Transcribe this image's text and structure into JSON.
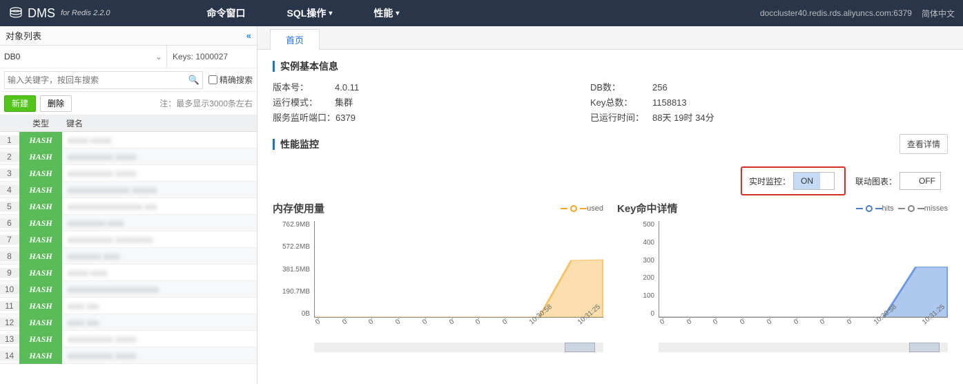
{
  "brand": "DMS",
  "brand_sub": "for Redis 2.2.0",
  "nav": {
    "cmd": "命令窗口",
    "sql": "SQL操作",
    "perf": "性能"
  },
  "host": "doccluster40.redis.rds.aliyuncs.com:6379",
  "lang": "简体中文",
  "sidebar": {
    "title": "对象列表",
    "db": "DB0",
    "keys_label": "Keys: 1000027",
    "search_placeholder": "输入关键字，按回车搜索",
    "exact_label": "精确搜索",
    "new_btn": "新建",
    "del_btn": "删除",
    "note": "注：最多显示3000条左右",
    "th_type": "类型",
    "th_key": "键名",
    "rows": [
      {
        "idx": "1",
        "type": "HASH",
        "key": "xxxxx   xxxxx"
      },
      {
        "idx": "2",
        "type": "HASH",
        "key": "xxxxxxxxxxx   xxxxx"
      },
      {
        "idx": "3",
        "type": "HASH",
        "key": "xxxxxxxxxxx   xxxxx"
      },
      {
        "idx": "4",
        "type": "HASH",
        "key": "xxxxxxxxxxxxxxx  xxxxxx"
      },
      {
        "idx": "5",
        "type": "HASH",
        "key": "xxxxxxxxxxxxxxxxxx  xxx"
      },
      {
        "idx": "6",
        "type": "HASH",
        "key": "xxxxxxxxx  xxxx"
      },
      {
        "idx": "7",
        "type": "HASH",
        "key": "xxxxxxxxxxx  xxxxxxxxx"
      },
      {
        "idx": "8",
        "type": "HASH",
        "key": "xxxxxxxx  xxxx"
      },
      {
        "idx": "9",
        "type": "HASH",
        "key": "xxxxx  xxxx"
      },
      {
        "idx": "10",
        "type": "HASH",
        "key": "xxxxxxxxxxxxxxxxxxxxxx"
      },
      {
        "idx": "11",
        "type": "HASH",
        "key": "xxxx  xxx"
      },
      {
        "idx": "12",
        "type": "HASH",
        "key": "xxxx  xxx"
      },
      {
        "idx": "13",
        "type": "HASH",
        "key": "xxxxxxxxxxx   xxxxx"
      },
      {
        "idx": "14",
        "type": "HASH",
        "key": "xxxxxxxxxxx   xxxxx"
      }
    ]
  },
  "main": {
    "tab_home": "首页",
    "section1": "实例基本信息",
    "info": {
      "version_k": "版本号：",
      "version_v": "4.0.11",
      "mode_k": "运行模式：",
      "mode_v": "集群",
      "port_k": "服务监听端口：",
      "port_v": "6379",
      "dbnum_k": "DB数：",
      "dbnum_v": "256",
      "keytotal_k": "Key总数：",
      "keytotal_v": "1158813",
      "uptime_k": "已运行时间：",
      "uptime_v": "88天 19时 34分"
    },
    "section2": "性能监控",
    "detail_btn": "查看详情",
    "realtime_label": "实时监控：",
    "realtime_on": "ON",
    "link_label": "联动图表：",
    "link_off": "OFF",
    "chart1": {
      "title": "内存使用量",
      "legend_used": "used"
    },
    "chart2": {
      "title": "Key命中详情",
      "legend_hits": "hits",
      "legend_misses": "misses"
    }
  },
  "chart_data": [
    {
      "type": "area",
      "title": "内存使用量",
      "ylabel": "",
      "ylim": [
        0,
        762.9
      ],
      "y_ticks": [
        "762.9MB",
        "572.2MB",
        "381.5MB",
        "190.7MB",
        "0B"
      ],
      "x_ticks": [
        "0'",
        "0'",
        "0'",
        "0'",
        "0'",
        "0'",
        "0'",
        "0'",
        "10:30:58",
        "10:31:25"
      ],
      "series": [
        {
          "name": "used",
          "color": "#f5c26b",
          "values": [
            0,
            0,
            0,
            0,
            0,
            0,
            0,
            0,
            450,
            455
          ]
        }
      ]
    },
    {
      "type": "area",
      "title": "Key命中详情",
      "ylabel": "",
      "ylim": [
        0,
        500
      ],
      "y_ticks": [
        "500",
        "400",
        "300",
        "200",
        "100",
        "0"
      ],
      "x_ticks": [
        "0'",
        "0'",
        "0'",
        "0'",
        "0'",
        "0'",
        "0'",
        "0'",
        "10:30:58",
        "10:31:25"
      ],
      "series": [
        {
          "name": "hits",
          "color": "#6b9ae0",
          "values": [
            0,
            0,
            0,
            0,
            0,
            0,
            0,
            0,
            260,
            260
          ]
        },
        {
          "name": "misses",
          "color": "#999999",
          "values": [
            0,
            0,
            0,
            0,
            0,
            0,
            0,
            0,
            0,
            0
          ]
        }
      ]
    }
  ]
}
